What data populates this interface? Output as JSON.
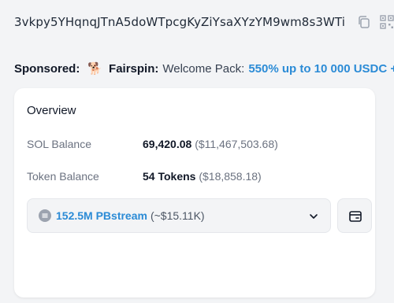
{
  "address": {
    "value": "3vkpy5YHqnqJTnA5doWTpcgKyZiYsaXYzYM9wm8s3WTi",
    "copy_icon": "copy-icon",
    "qr_icon": "qr-code-icon"
  },
  "sponsor": {
    "label": "Sponsored:",
    "icon": "dog-icon",
    "brand": "Fairspin:",
    "text": "Welcome Pack:",
    "link": "550% up to 10 000 USDC +"
  },
  "overview": {
    "title": "Overview",
    "sol_label": "SOL Balance",
    "sol_value": "69,420.08",
    "sol_usd": "($11,467,503.68)",
    "token_label": "Token Balance",
    "token_value": "54 Tokens",
    "token_usd": "($18,858.18)",
    "selected_token": {
      "name": "152.5M PBstream",
      "usd": "(~$15.11K)"
    },
    "wallet_icon": "wallet-icon"
  },
  "colors": {
    "accent": "#2b8bd6",
    "background": "#f3f4f6",
    "card": "#ffffff"
  }
}
